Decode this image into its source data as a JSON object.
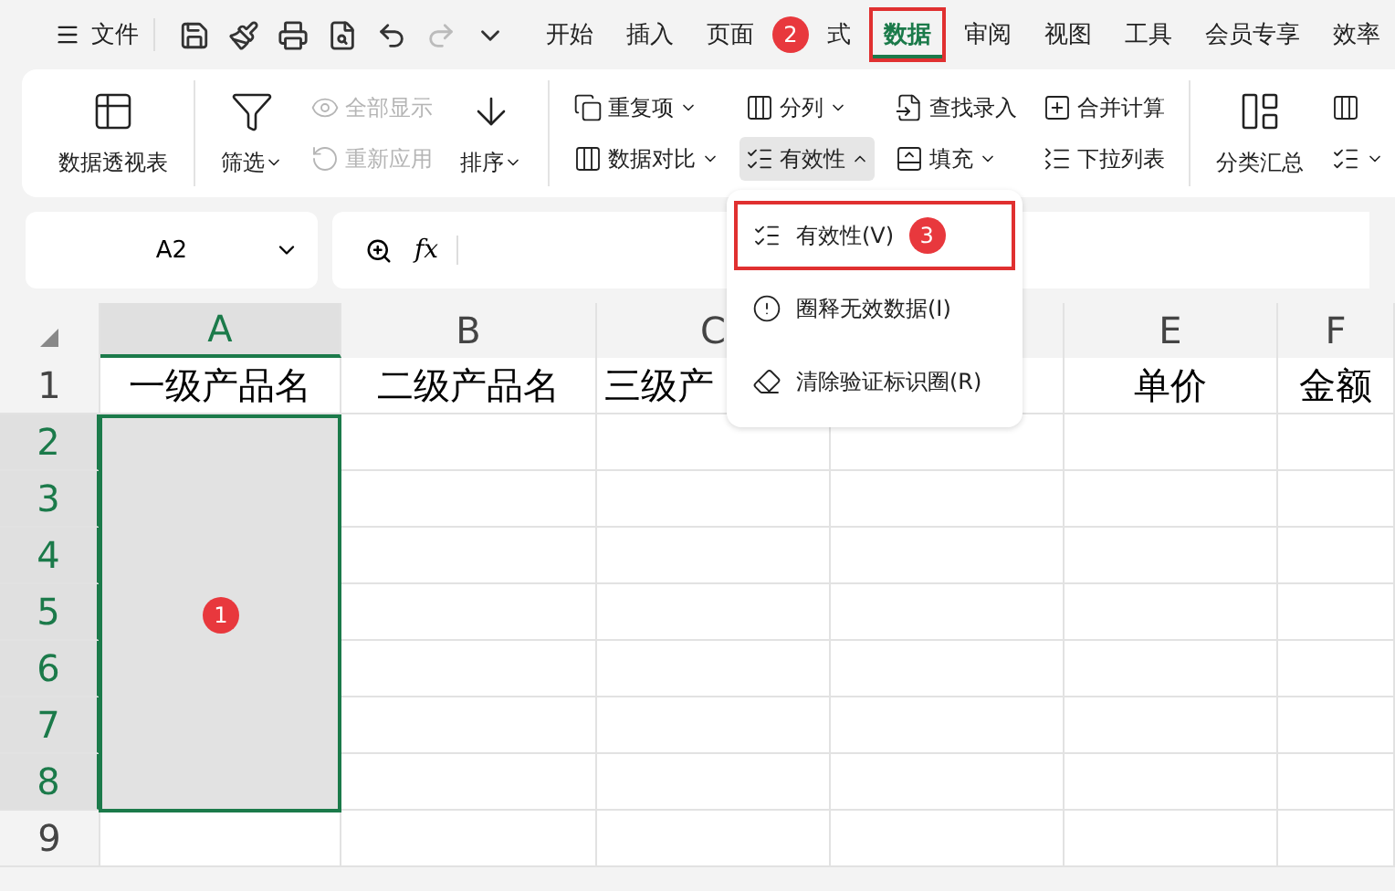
{
  "topbar": {
    "file_label": "文件",
    "tabs": [
      {
        "label": "开始",
        "selected": false,
        "highlighted": false
      },
      {
        "label": "插入",
        "selected": false,
        "highlighted": false
      },
      {
        "label": "页面",
        "selected": false,
        "highlighted": false
      },
      {
        "label": "式",
        "selected": false,
        "highlighted": false,
        "badge": "2"
      },
      {
        "label": "数据",
        "selected": true,
        "highlighted": true
      },
      {
        "label": "审阅",
        "selected": false,
        "highlighted": false
      },
      {
        "label": "视图",
        "selected": false,
        "highlighted": false
      },
      {
        "label": "工具",
        "selected": false,
        "highlighted": false
      },
      {
        "label": "会员专享",
        "selected": false,
        "highlighted": false
      },
      {
        "label": "效率",
        "selected": false,
        "highlighted": false
      }
    ]
  },
  "ribbon": {
    "groups": [
      {
        "columns": [
          {
            "kind": "large",
            "label": "数据透视表",
            "dropdown": false
          }
        ]
      },
      {
        "columns": [
          {
            "kind": "large",
            "label": "筛选",
            "dropdown": true
          },
          {
            "kind": "stack",
            "items": [
              {
                "label": "全部显示",
                "disabled": true,
                "dropdown": false,
                "pressed": false
              },
              {
                "label": "重新应用",
                "disabled": true,
                "dropdown": false,
                "pressed": false
              }
            ]
          },
          {
            "kind": "large",
            "label": "排序",
            "dropdown": true
          }
        ]
      },
      {
        "columns": [
          {
            "kind": "stack",
            "items": [
              {
                "label": "重复项",
                "disabled": false,
                "dropdown": true,
                "pressed": false
              },
              {
                "label": "数据对比",
                "disabled": false,
                "dropdown": true,
                "pressed": false
              }
            ]
          },
          {
            "kind": "stack",
            "items": [
              {
                "label": "分列",
                "disabled": false,
                "dropdown": true,
                "pressed": false
              },
              {
                "label": "有效性",
                "disabled": false,
                "dropdown": true,
                "pressed": true
              }
            ]
          },
          {
            "kind": "stack",
            "items": [
              {
                "label": "查找录入",
                "disabled": false,
                "dropdown": false,
                "pressed": false
              },
              {
                "label": "填充",
                "disabled": false,
                "dropdown": true,
                "pressed": false
              }
            ]
          },
          {
            "kind": "stack",
            "items": [
              {
                "label": "合并计算",
                "disabled": false,
                "dropdown": false,
                "pressed": false
              },
              {
                "label": "下拉列表",
                "disabled": false,
                "dropdown": false,
                "pressed": false
              }
            ]
          }
        ]
      },
      {
        "columns": [
          {
            "kind": "large",
            "label": "分类汇总",
            "dropdown": false
          },
          {
            "kind": "stack",
            "items": [
              {
                "disabled": false,
                "dropdown": false,
                "pressed": false
              },
              {
                "disabled": false,
                "dropdown": true,
                "pressed": false
              }
            ]
          }
        ]
      }
    ]
  },
  "formula_bar": {
    "cell_ref": "A2",
    "fx": "fx"
  },
  "grid": {
    "columns": [
      {
        "label": "A",
        "selected": true
      },
      {
        "label": "B",
        "selected": false
      },
      {
        "label": "C",
        "selected": false
      },
      {
        "selected": false
      },
      {
        "label": "E",
        "selected": false
      },
      {
        "label": "F",
        "selected": false
      }
    ],
    "rows": [
      {
        "label": "1",
        "selected": false,
        "cells": [
          "一级产品名",
          "二级产品名",
          "三级产",
          "",
          "单价",
          "金额"
        ]
      },
      {
        "label": "2",
        "selected": true,
        "cells": [
          "",
          "",
          "",
          "",
          "",
          ""
        ]
      },
      {
        "label": "3",
        "selected": true,
        "cells": [
          "",
          "",
          "",
          "",
          "",
          ""
        ]
      },
      {
        "label": "4",
        "selected": true,
        "cells": [
          "",
          "",
          "",
          "",
          "",
          ""
        ]
      },
      {
        "label": "5",
        "selected": true,
        "cells": [
          "",
          "",
          "",
          "",
          "",
          ""
        ]
      },
      {
        "label": "6",
        "selected": true,
        "cells": [
          "",
          "",
          "",
          "",
          "",
          ""
        ]
      },
      {
        "label": "7",
        "selected": true,
        "cells": [
          "",
          "",
          "",
          "",
          "",
          ""
        ]
      },
      {
        "label": "8",
        "selected": true,
        "cells": [
          "",
          "",
          "",
          "",
          "",
          ""
        ]
      },
      {
        "label": "9",
        "selected": false,
        "cells": [
          "",
          "",
          "",
          "",
          "",
          ""
        ]
      }
    ],
    "badge": "1"
  },
  "dropdown_menu": {
    "items": [
      {
        "label": "有效性(V)",
        "highlighted": true,
        "badge": "3"
      },
      {
        "label": "圈释无效数据(I)",
        "highlighted": false
      },
      {
        "label": "清除验证标识圈(R)",
        "highlighted": false
      }
    ]
  }
}
